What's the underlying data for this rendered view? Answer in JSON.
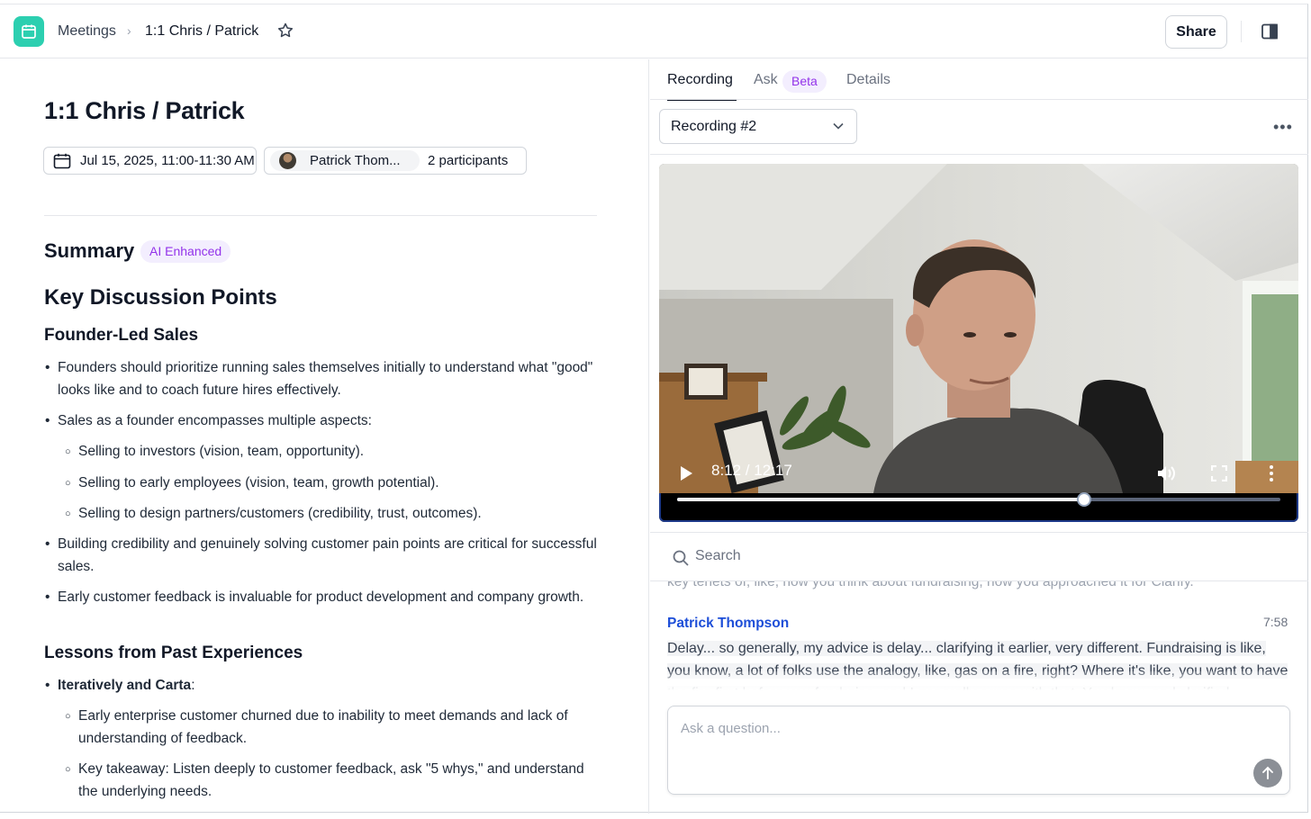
{
  "breadcrumb": {
    "root": "Meetings",
    "current": "1:1 Chris / Patrick"
  },
  "toolbar": {
    "share_label": "Share"
  },
  "meeting": {
    "title": "1:1 Chris / Patrick",
    "datetime": "Jul 15, 2025, 11:00-11:30 AM",
    "participant_name": "Patrick Thom...",
    "participant_count": "2 participants"
  },
  "summary": {
    "heading": "Summary",
    "badge": "AI Enhanced"
  },
  "notes": {
    "main_heading": "Key Discussion Points",
    "section1": {
      "heading": "Founder-Led Sales",
      "bullets": [
        "Founders should prioritize running sales themselves initially to understand what \"good\" looks like and to coach future hires effectively.",
        "Sales as a founder encompasses multiple aspects:",
        "Building credibility and genuinely solving customer pain points are critical for successful sales.",
        "Early customer feedback is invaluable for product development and company growth."
      ],
      "sub_bullets": [
        "Selling to investors (vision, team, opportunity).",
        "Selling to early employees (vision, team, growth potential).",
        "Selling to design partners/customers (credibility, trust, outcomes)."
      ]
    },
    "section2": {
      "heading": "Lessons from Past Experiences",
      "bullet_bold": "Iteratively and Carta",
      "bullet_rest": ":",
      "sub_bullets": [
        "Early enterprise customer churned due to inability to meet demands and lack of understanding of feedback.",
        "Key takeaway: Listen deeply to customer feedback, ask \"5 whys,\" and understand the underlying needs."
      ]
    }
  },
  "tabs": {
    "recording": "Recording",
    "ask": "Ask",
    "ask_badge": "Beta",
    "details": "Details"
  },
  "recording_select": {
    "value": "Recording #2"
  },
  "player": {
    "time": "8:12 / 12:17",
    "progress": 0.674
  },
  "transcript": {
    "search_placeholder": "Search",
    "previous_line": "key tenets of, like, how you think about fundraising, how you approached it for Clarify.",
    "speaker": "Patrick Thompson",
    "timestamp": "7:58",
    "text": "Delay... so generally, my advice is delay... clarifying it earlier, very different. Fundraising is like, you know, a lot of folks use the analogy, like, gas on a fire, right? Where it's like, you want to have the fire first before you fundraise, and I generally agree with that. You know, and clarified"
  },
  "ask": {
    "placeholder": "Ask a question..."
  },
  "colors": {
    "accent": "#2ccfb0",
    "speaker": "#1d4ed8",
    "badge": "#9333ea"
  },
  "icons": [
    "calendar-icon",
    "chevron-right-icon",
    "star-icon",
    "panel-toggle-icon",
    "chevron-down-icon",
    "more-icon",
    "play-icon",
    "volume-icon",
    "fullscreen-icon",
    "search-icon",
    "arrow-up-icon"
  ]
}
